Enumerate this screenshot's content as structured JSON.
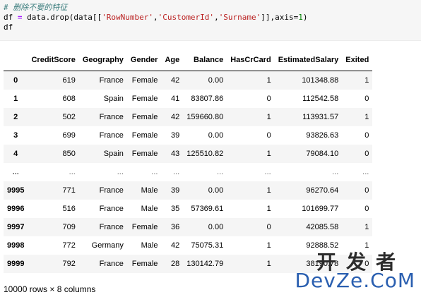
{
  "code_cell": {
    "comment": "# 删除不要的特征",
    "line2": {
      "var": "df",
      "op": "=",
      "call_prefix": "data.drop(data[[",
      "col1": "'RowNumber'",
      "sep1": ",",
      "col2": "'CustomerId'",
      "sep2": ",",
      "col3": "'Surname'",
      "call_mid": "]],axis=",
      "axis": "1",
      "call_end": ")"
    },
    "line3": "df"
  },
  "dataframe": {
    "columns": [
      "CreditScore",
      "Geography",
      "Gender",
      "Age",
      "Balance",
      "HasCrCard",
      "EstimatedSalary",
      "Exited"
    ],
    "rows": [
      {
        "index": "0",
        "cells": [
          "619",
          "France",
          "Female",
          "42",
          "0.00",
          "1",
          "101348.88",
          "1"
        ]
      },
      {
        "index": "1",
        "cells": [
          "608",
          "Spain",
          "Female",
          "41",
          "83807.86",
          "0",
          "112542.58",
          "0"
        ]
      },
      {
        "index": "2",
        "cells": [
          "502",
          "France",
          "Female",
          "42",
          "159660.80",
          "1",
          "113931.57",
          "1"
        ]
      },
      {
        "index": "3",
        "cells": [
          "699",
          "France",
          "Female",
          "39",
          "0.00",
          "0",
          "93826.63",
          "0"
        ]
      },
      {
        "index": "4",
        "cells": [
          "850",
          "Spain",
          "Female",
          "43",
          "125510.82",
          "1",
          "79084.10",
          "0"
        ]
      },
      {
        "index": "...",
        "cells": [
          "...",
          "...",
          "...",
          "...",
          "...",
          "...",
          "...",
          "..."
        ]
      },
      {
        "index": "9995",
        "cells": [
          "771",
          "France",
          "Male",
          "39",
          "0.00",
          "1",
          "96270.64",
          "0"
        ]
      },
      {
        "index": "9996",
        "cells": [
          "516",
          "France",
          "Male",
          "35",
          "57369.61",
          "1",
          "101699.77",
          "0"
        ]
      },
      {
        "index": "9997",
        "cells": [
          "709",
          "France",
          "Female",
          "36",
          "0.00",
          "0",
          "42085.58",
          "1"
        ]
      },
      {
        "index": "9998",
        "cells": [
          "772",
          "Germany",
          "Male",
          "42",
          "75075.31",
          "1",
          "92888.52",
          "1"
        ]
      },
      {
        "index": "9999",
        "cells": [
          "792",
          "France",
          "Female",
          "28",
          "130142.79",
          "1",
          "38190.78",
          "0"
        ]
      }
    ],
    "shape_info": "10000 rows × 8 columns"
  },
  "watermark": {
    "cn": "开发者",
    "en": "DevZe.CoM"
  },
  "colors": {
    "code_background": "#f6f6f6",
    "comment": "#408080",
    "string": "#ba2121",
    "operator": "#aa22ff",
    "number": "#008000",
    "stripe": "#f5f5f5",
    "watermark_blue": "#2a5fb0"
  }
}
